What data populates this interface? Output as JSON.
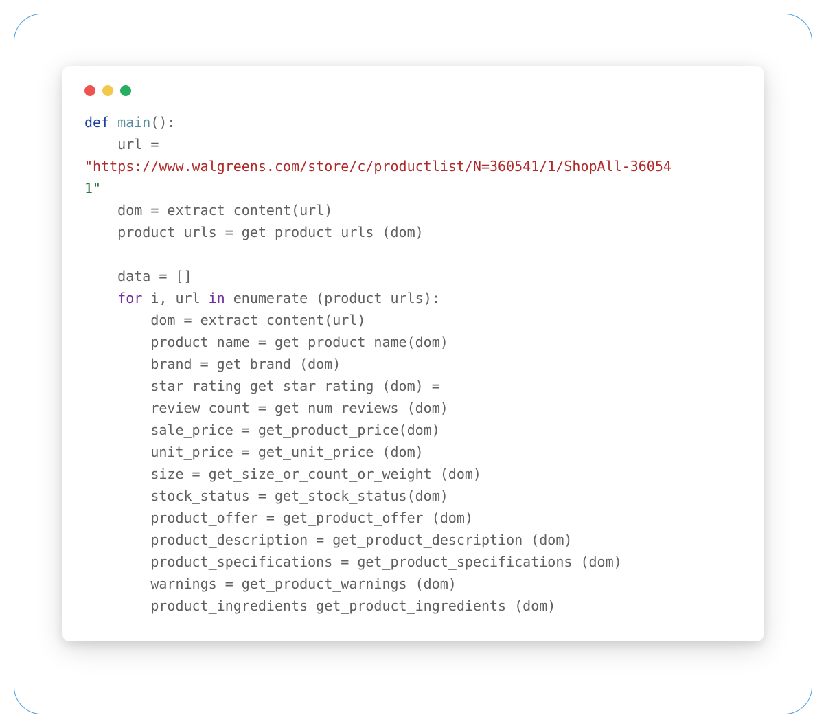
{
  "trafficLights": {
    "red": "#ed5350",
    "yellow": "#f2c94c",
    "green": "#27ae60"
  },
  "code": {
    "line1_def": "def",
    "line1_fn": " main",
    "line1_rest": "():",
    "line2_indent": "    url =",
    "line3_str": "\"https://www.walgreens.com/store/c/productlist/N=360541/1/ShopAll-36054",
    "line4_str": "1\"",
    "line5": "    dom = extract_content(url)",
    "line6": "    product_urls = get_product_urls (dom)",
    "line7": "",
    "line8": "    data = []",
    "line9_indent": "    ",
    "line9_for": "for",
    "line9_mid": " i, url ",
    "line9_in": "in",
    "line9_rest": " enumerate (product_urls):",
    "line10": "        dom = extract_content(url)",
    "line11": "        product_name = get_product_name(dom)",
    "line12": "        brand = get_brand (dom)",
    "line13": "        star_rating get_star_rating (dom) =",
    "line14": "        review_count = get_num_reviews (dom)",
    "line15": "        sale_price = get_product_price(dom)",
    "line16": "        unit_price = get_unit_price (dom)",
    "line17": "        size = get_size_or_count_or_weight (dom)",
    "line18": "        stock_status = get_stock_status(dom)",
    "line19": "        product_offer = get_product_offer (dom)",
    "line20": "        product_description = get_product_description (dom)",
    "line21": "        product_specifications = get_product_specifications (dom)",
    "line22": "        warnings = get_product_warnings (dom)",
    "line23": "        product_ingredients get_product_ingredients (dom)"
  }
}
